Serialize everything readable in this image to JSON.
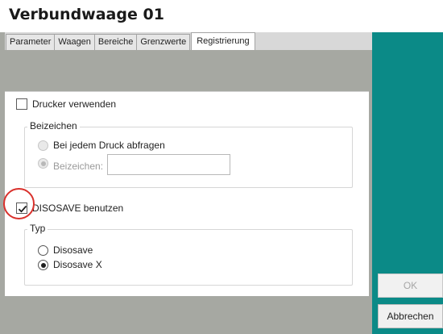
{
  "window": {
    "title": "Verbundwaage 01"
  },
  "tabs": [
    {
      "label": "Parameter"
    },
    {
      "label": "Waagen"
    },
    {
      "label": "Bereiche"
    },
    {
      "label": "Grenzwerte"
    },
    {
      "label": "Registrierung",
      "active": true
    }
  ],
  "printer": {
    "label": "Drucker verwenden",
    "checked": false,
    "group_label": "Beizeichen",
    "options": [
      {
        "label": "Bei jedem Druck abfragen",
        "selected": false,
        "enabled": false
      },
      {
        "label": "Beizeichen:",
        "selected": true,
        "enabled": false
      }
    ],
    "beizeichen_value": ""
  },
  "disosave": {
    "label": "DISOSAVE benutzen",
    "checked": true,
    "group_label": "Typ",
    "options": [
      {
        "label": "Disosave",
        "selected": false
      },
      {
        "label": "Disosave X",
        "selected": true
      }
    ]
  },
  "buttons": {
    "ok": "OK",
    "cancel": "Abbrechen"
  },
  "colors": {
    "accent": "#0b8a87",
    "background": "#a6a8a2",
    "annotation": "#d9302b"
  }
}
